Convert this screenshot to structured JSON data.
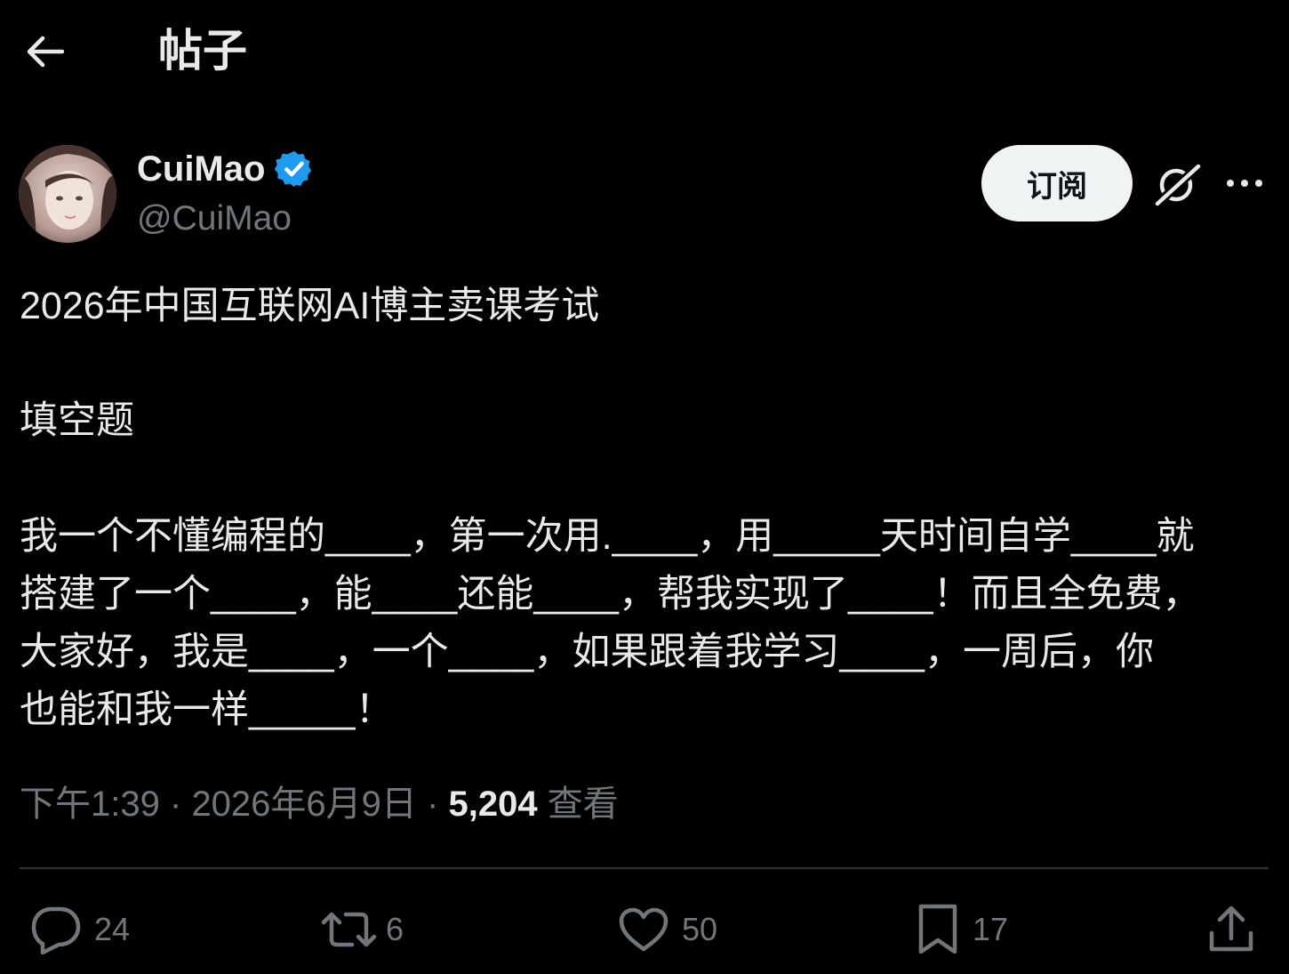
{
  "header": {
    "title": "帖子"
  },
  "author": {
    "display_name": "CuiMao",
    "handle": "@CuiMao",
    "verified": true
  },
  "buttons": {
    "subscribe": "订阅"
  },
  "post": {
    "title_line": "2026年中国互联网AI博主卖课考试",
    "subtitle_line": "填空题",
    "body_lines": [
      "我一个不懂编程的____，第一次用.____，用_____天时间自学____就",
      "搭建了一个____，能____还能____，帮我实现了____！而且全免费，",
      "大家好，我是____，一个____，如果跟着我学习____，一周后，你",
      "也能和我一样_____！"
    ]
  },
  "meta": {
    "time": "下午1:39",
    "date": "2026年6月9日",
    "views_count": "5,204",
    "views_label": "查看",
    "separator": "·"
  },
  "actions": {
    "replies": "24",
    "reposts": "6",
    "likes": "50",
    "bookmarks": "17"
  },
  "colors": {
    "background": "#000000",
    "text_primary": "#e7e9ea",
    "text_secondary": "#71767b",
    "verified_badge": "#1d9bf0",
    "subscribe_bg": "#eff3f4",
    "divider": "#2f3336"
  },
  "icons": [
    "back-arrow-icon",
    "verified-badge-icon",
    "grok-icon",
    "more-icon",
    "reply-icon",
    "repost-icon",
    "like-icon",
    "bookmark-icon",
    "share-icon"
  ]
}
